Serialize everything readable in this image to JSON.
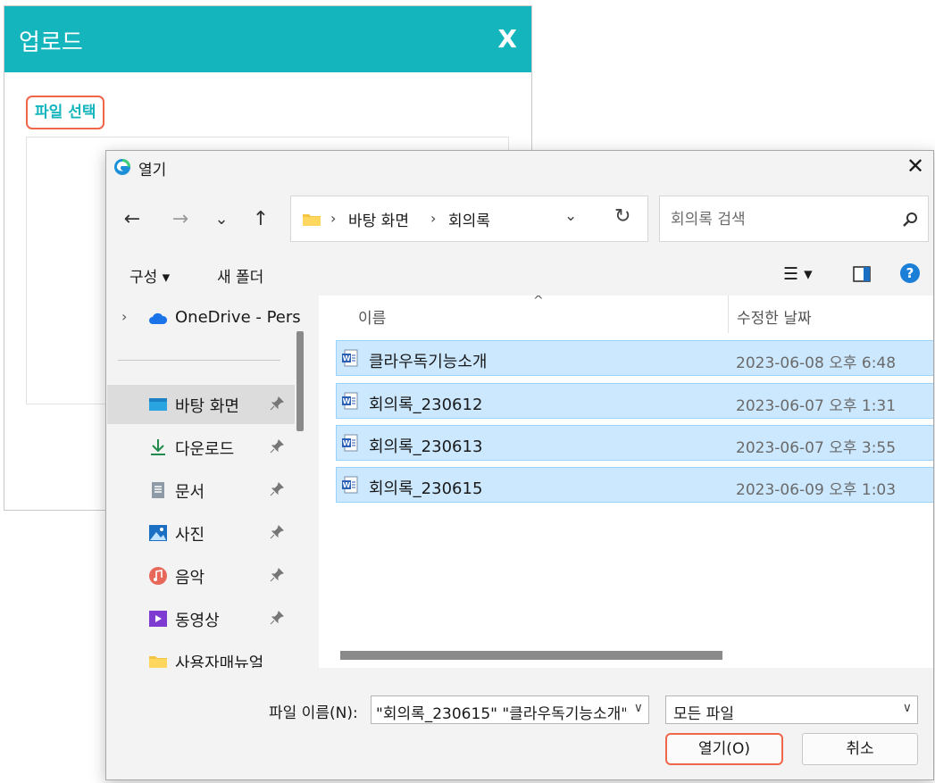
{
  "upload_dialog": {
    "title": "업로드",
    "close_label": "X",
    "file_select_label": "파일 선택"
  },
  "open_dialog": {
    "title": "열기",
    "nav": {
      "back": "←",
      "forward": "→",
      "recent": "⌄",
      "up": "↑"
    },
    "address": {
      "crumbs": [
        "바탕 화면",
        "회의록"
      ],
      "separator": "›"
    },
    "search": {
      "placeholder": "회의록 검색"
    },
    "command_bar": {
      "organize": "구성 ▾",
      "new_folder": "새 폴더"
    },
    "nav_pane": {
      "items": [
        {
          "label": "OneDrive - Pers",
          "icon": "cloud-icon"
        },
        {
          "label": "바탕 화면",
          "icon": "desktop-icon",
          "pinned": true,
          "selected": true
        },
        {
          "label": "다운로드",
          "icon": "download-icon",
          "pinned": true
        },
        {
          "label": "문서",
          "icon": "document-icon",
          "pinned": true
        },
        {
          "label": "사진",
          "icon": "picture-icon",
          "pinned": true
        },
        {
          "label": "음악",
          "icon": "music-icon",
          "pinned": true
        },
        {
          "label": "동영상",
          "icon": "video-icon",
          "pinned": true
        },
        {
          "label": "사용자매뉴얼",
          "icon": "folder-icon"
        }
      ]
    },
    "columns": {
      "name": "이름",
      "modified": "수정한 날짜"
    },
    "files": [
      {
        "name": "클라우독기능소개",
        "modified": "2023-06-08 오후 6:48",
        "selected": true
      },
      {
        "name": "회의록_230612",
        "modified": "2023-06-07 오후 1:31",
        "selected": true
      },
      {
        "name": "회의록_230613",
        "modified": "2023-06-07 오후 3:55",
        "selected": true
      },
      {
        "name": "회의록_230615",
        "modified": "2023-06-09 오후 1:03",
        "selected": true
      }
    ],
    "footer": {
      "filename_label": "파일 이름(N):",
      "filename_value": "\"회의록_230615\" \"클라우독기능소개\"",
      "filetype": "모든 파일",
      "open_button": "열기(O)",
      "cancel_button": "취소"
    },
    "colors": {
      "accent": "#14b5bd",
      "highlight": "#f0664a",
      "selection": "#cce8ff"
    }
  }
}
